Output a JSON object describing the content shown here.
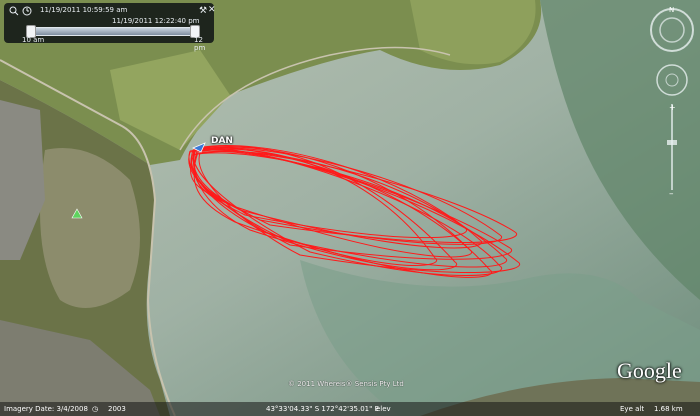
{
  "timeline": {
    "start_time": "11/19/2011  10:59:59 am",
    "end_time": "11/19/2011  12:22:40 pm",
    "left_label": "10 am",
    "right_label": "12 pm",
    "range": [
      0,
      1
    ]
  },
  "track": {
    "label": "DAN",
    "color": "#ff1a1a"
  },
  "map": {
    "copyright": "© 2011 Whereis® Sensis Pty Ltd",
    "logo": "Google"
  },
  "status_bar": {
    "imagery_date": "Imagery Date: 3/4/2008",
    "year": "2003",
    "coordinates": "43°33'04.33\" S  172°42'35.01\" E",
    "elev": "elev",
    "eye_alt": "Eye alt",
    "eye_alt_value": "1.68 km"
  },
  "icons": {
    "zoom": "magnifier-icon",
    "clock": "clock-icon",
    "settings": "wrench-icon",
    "close": "close-icon",
    "compass": "compass-icon",
    "pan": "pan-icon",
    "zoom_slider": "zoom-slider-icon",
    "boat": "boat-icon",
    "tree": "tree-icon"
  }
}
